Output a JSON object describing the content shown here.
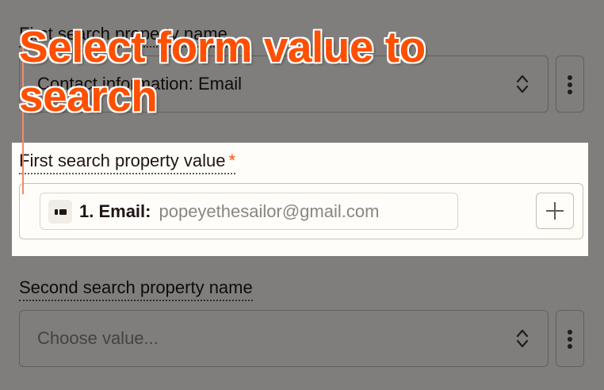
{
  "callout": {
    "text": "Select form value to search",
    "color": "#ff4f00"
  },
  "first_name_field": {
    "label": "First search property name",
    "selected_value": "Contact information: Email",
    "toggle_icon": "chevron-up-down-icon",
    "more_icon": "vertical-ellipsis-icon"
  },
  "first_value_field": {
    "label": "First search property value",
    "required_marker": "*",
    "pill": {
      "icon": "app-logo-icon",
      "step_label": "1. Email:",
      "value": "popeyethesailor@gmail.com"
    },
    "add_icon": "plus-icon"
  },
  "second_name_field": {
    "label": "Second search property name",
    "placeholder": "Choose value...",
    "toggle_icon": "chevron-up-down-icon",
    "more_icon": "vertical-ellipsis-icon"
  },
  "colors": {
    "accent": "#ff4f00",
    "background": "#fffdf9",
    "border": "#c5c0b1",
    "text": "#201515"
  }
}
